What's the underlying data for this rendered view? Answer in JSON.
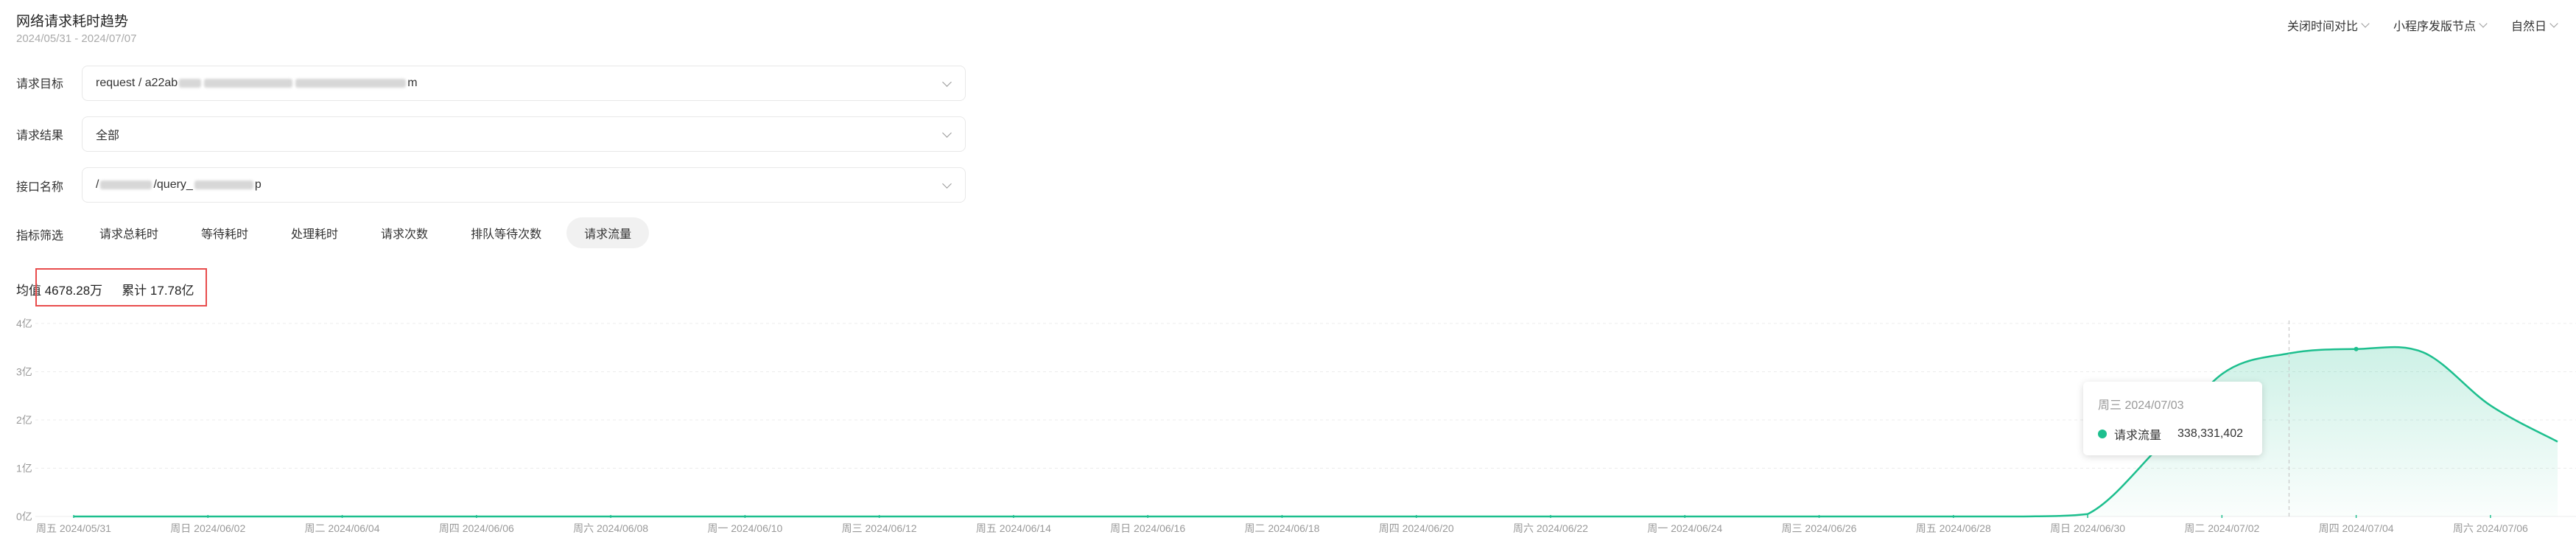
{
  "header": {
    "title": "网络请求耗时趋势",
    "date_range": "2024/05/31 - 2024/07/07"
  },
  "top_controls": [
    {
      "label": "关闭时间对比"
    },
    {
      "label": "小程序发版节点"
    },
    {
      "label": "自然日"
    }
  ],
  "filters": {
    "target": {
      "label": "请求目标",
      "value_prefix": "request / a22ab",
      "value_suffix": "m"
    },
    "result": {
      "label": "请求结果",
      "value": "全部"
    },
    "api": {
      "label": "接口名称",
      "value_prefix": "/",
      "value_mid": "/query_",
      "value_suffix": "p"
    }
  },
  "metrics": {
    "label": "指标筛选",
    "chips": [
      "请求总耗时",
      "等待耗时",
      "处理耗时",
      "请求次数",
      "排队等待次数",
      "请求流量"
    ],
    "active_index": 5
  },
  "summary": {
    "avg": "均值 4678.28万",
    "total": "累计 17.78亿"
  },
  "tooltip": {
    "date": "周三 2024/07/03",
    "series": "请求流量",
    "value": "338,331,402"
  },
  "colors": {
    "line": "#1dbf8e",
    "highlight": "#e84c4c"
  },
  "chart_data": {
    "type": "area",
    "y_ticks": [
      "0亿",
      "1亿",
      "2亿",
      "3亿",
      "4亿"
    ],
    "ylim": [
      0,
      4
    ],
    "x_tick_labels": [
      "周五 2024/05/31",
      "周日 2024/06/02",
      "周二 2024/06/04",
      "周四 2024/06/06",
      "周六 2024/06/08",
      "周一 2024/06/10",
      "周三 2024/06/12",
      "周五 2024/06/14",
      "周日 2024/06/16",
      "周二 2024/06/18",
      "周四 2024/06/20",
      "周六 2024/06/22",
      "周一 2024/06/24",
      "周三 2024/06/26",
      "周五 2024/06/28",
      "周日 2024/06/30",
      "周二 2024/07/02",
      "周四 2024/07/04",
      "周六 2024/07/06"
    ],
    "series": [
      {
        "name": "请求流量",
        "values": [
          0,
          0,
          0,
          0,
          0,
          0,
          0,
          0,
          0,
          0,
          0,
          0,
          0,
          0,
          0,
          0,
          0,
          0,
          0,
          0,
          0,
          0,
          0,
          0,
          0,
          0,
          0,
          0,
          0,
          0,
          0.05,
          1.35,
          2.95,
          3.38,
          3.47,
          3.4,
          2.3,
          1.55
        ]
      }
    ],
    "hover_index": 33,
    "grid": true,
    "legend": "none"
  }
}
